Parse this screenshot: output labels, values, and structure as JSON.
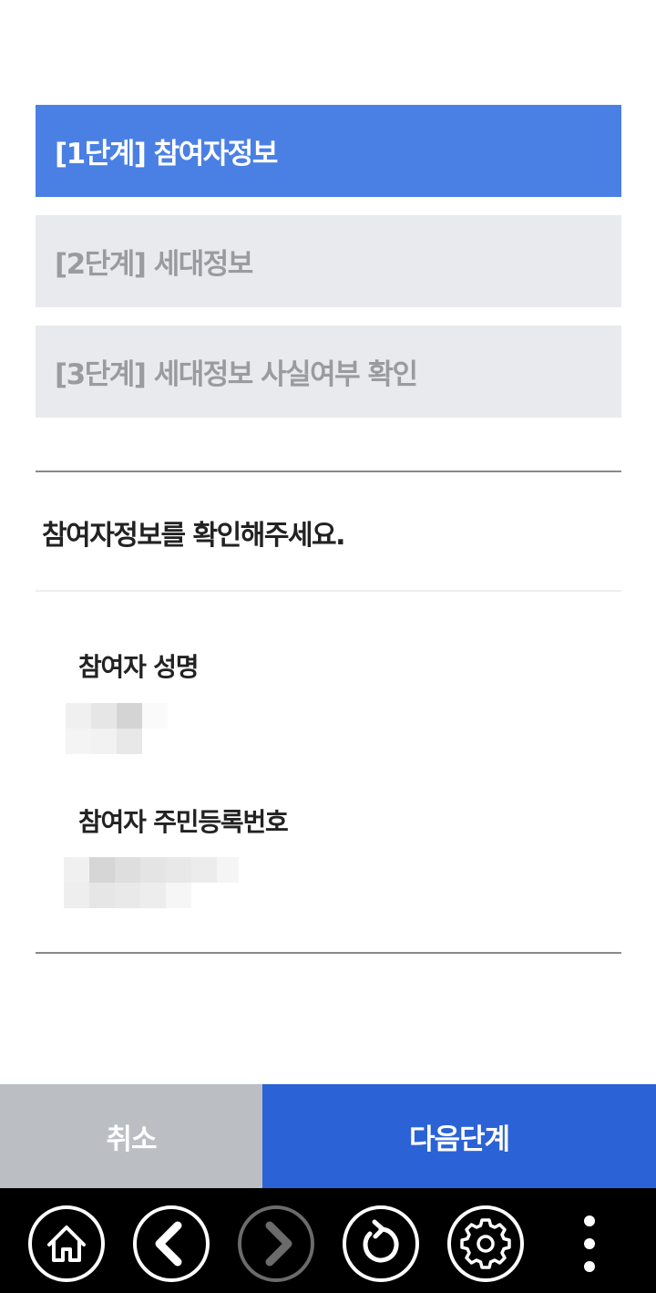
{
  "steps": [
    {
      "label": "[1단계] 참여자정보",
      "active": true
    },
    {
      "label": "[2단계] 세대정보",
      "active": false
    },
    {
      "label": "[3단계] 세대정보 사실여부 확인",
      "active": false
    }
  ],
  "main": {
    "heading": "참여자정보를 확인해주세요.",
    "fields": [
      {
        "label": "참여자 성명",
        "value_redacted": true
      },
      {
        "label": "참여자 주민등록번호",
        "value_redacted": true
      }
    ]
  },
  "buttons": {
    "cancel": "취소",
    "next": "다음단계"
  },
  "colors": {
    "active_step": "#4a80e4",
    "inactive_step": "#e9eaee",
    "next_button": "#2b63d6",
    "cancel_button": "#bbbec3",
    "navbar": "#000000"
  },
  "navbar": {
    "icons": [
      "home-icon",
      "back-icon",
      "forward-icon",
      "refresh-icon",
      "gear-icon",
      "more-vertical-icon"
    ]
  }
}
